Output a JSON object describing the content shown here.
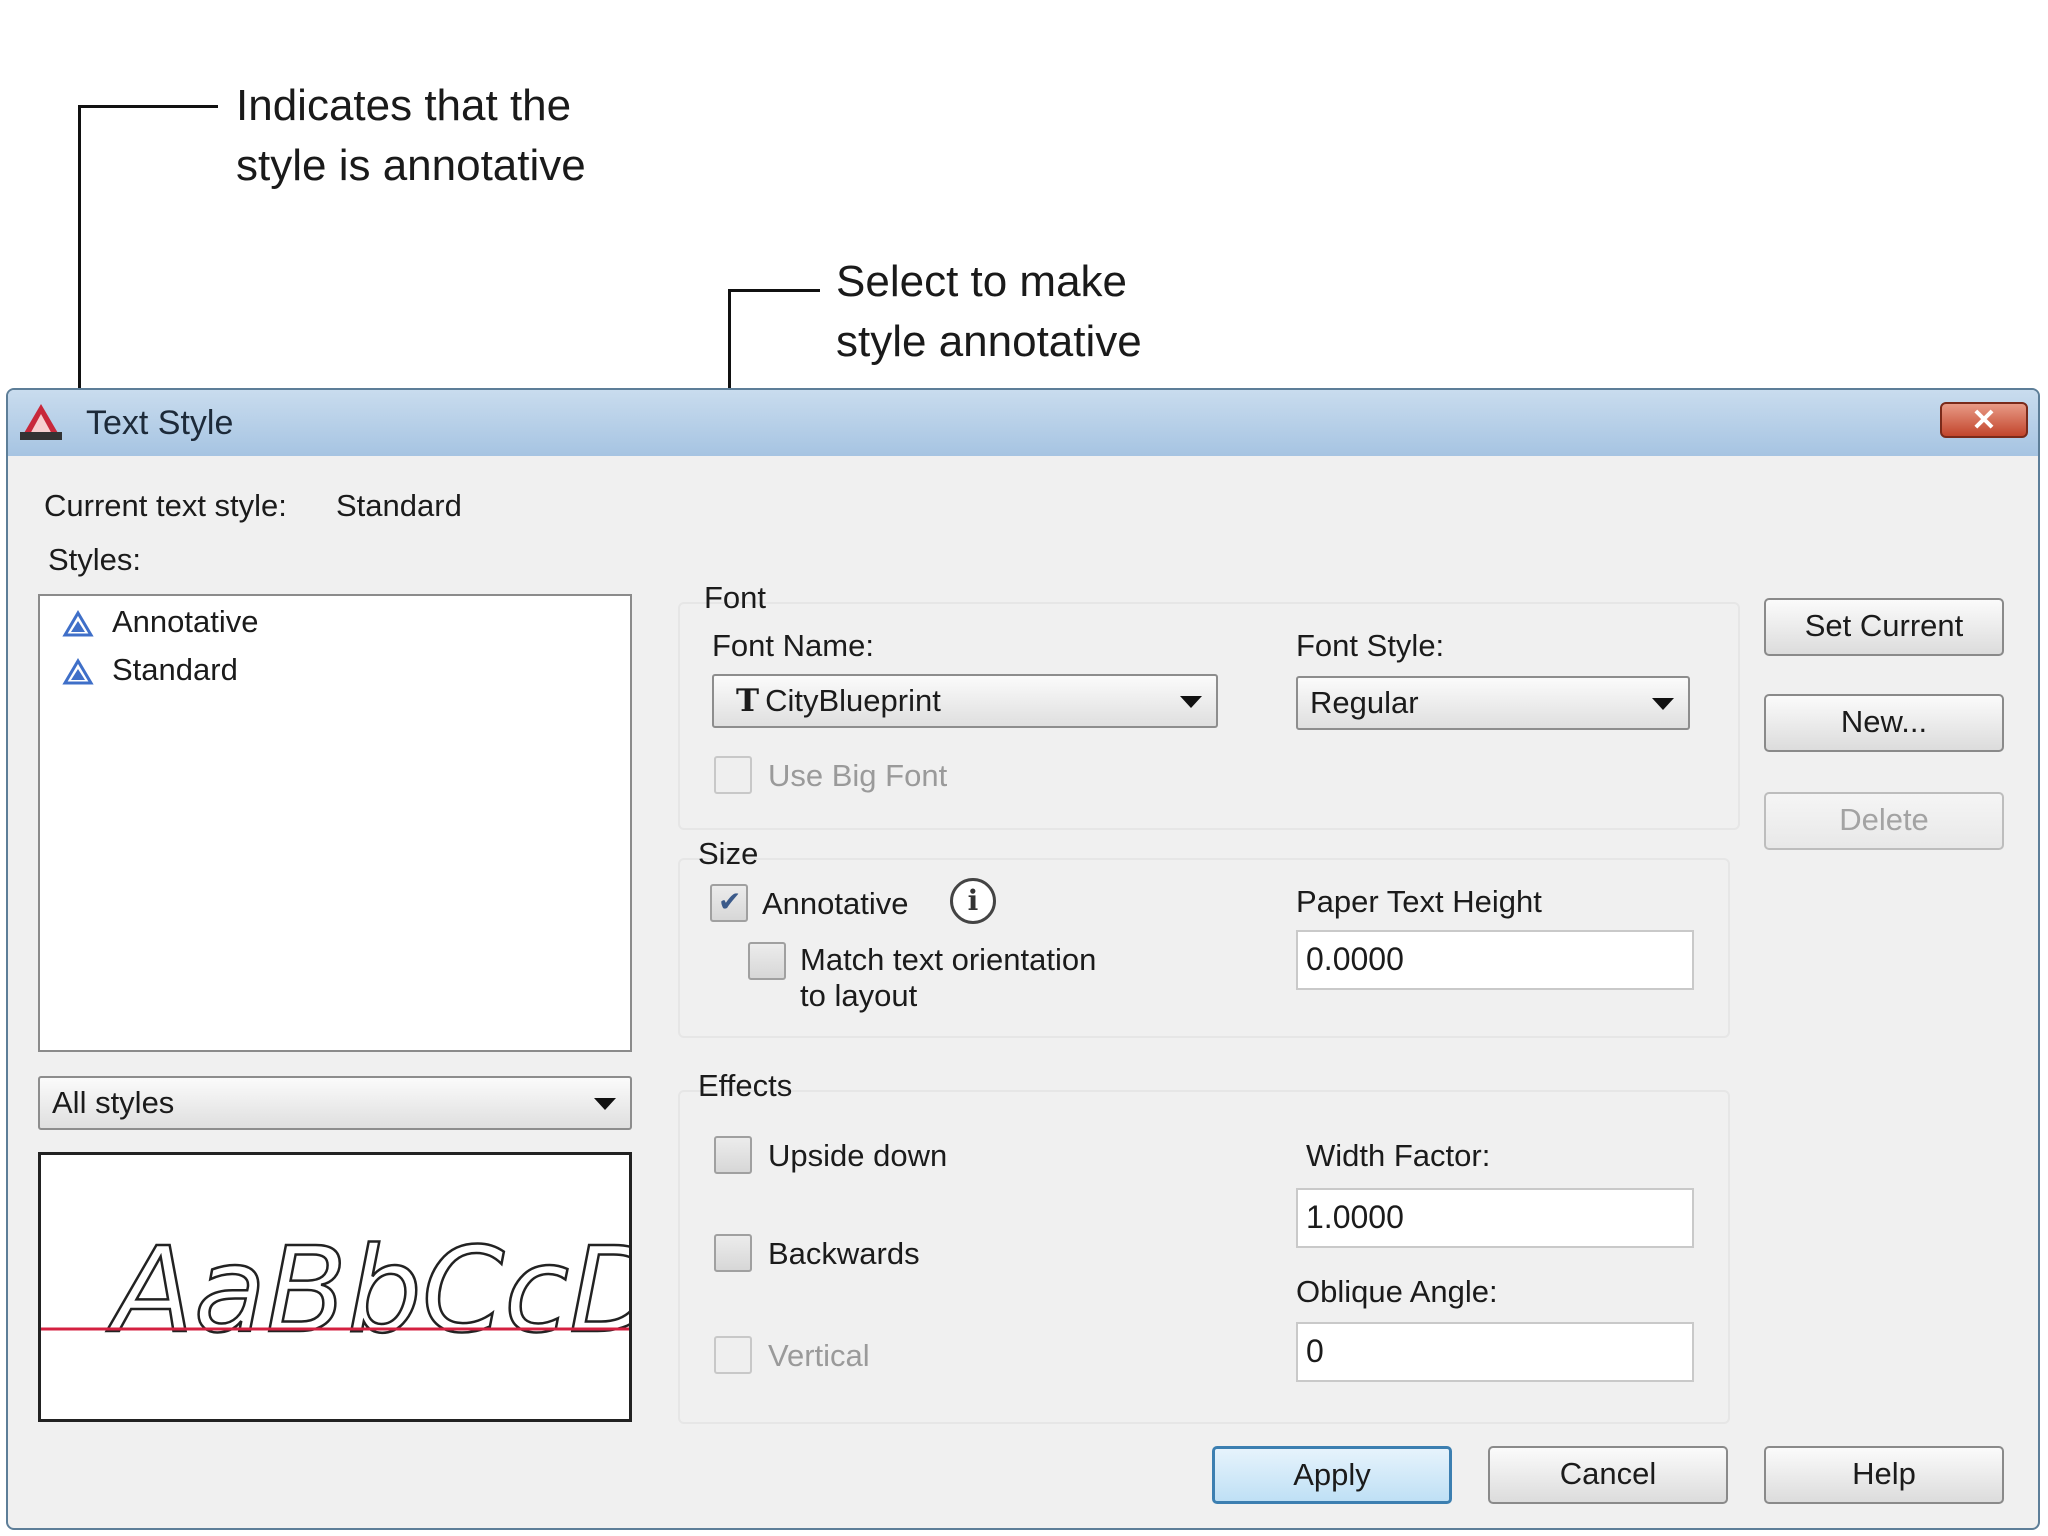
{
  "callouts": {
    "annotative_indicator": "Indicates that the\nstyle is annotative",
    "select_annotative": "Select to make\nstyle annotative"
  },
  "window": {
    "title": "Text Style",
    "close_label": "✕"
  },
  "current_style": {
    "label": "Current text style:",
    "value": "Standard"
  },
  "styles": {
    "label": "Styles:",
    "items": [
      {
        "label": "Annotative",
        "icon": "annotative-triangle-icon"
      },
      {
        "label": "Standard",
        "icon": "annotative-triangle-icon"
      }
    ],
    "filter_value": "All styles"
  },
  "preview_text": "AaBbCcD",
  "font": {
    "group_label": "Font",
    "font_name_label": "Font Name:",
    "font_name_value": "CityBlueprint",
    "font_style_label": "Font Style:",
    "font_style_value": "Regular",
    "use_big_font_label": "Use Big Font"
  },
  "size": {
    "group_label": "Size",
    "annotative_label": "Annotative",
    "annotative_checked": true,
    "match_orientation_label": "Match text orientation\nto layout",
    "paper_text_height_label": "Paper Text Height",
    "paper_text_height_value": "0.0000"
  },
  "effects": {
    "group_label": "Effects",
    "upside_down_label": "Upside down",
    "backwards_label": "Backwards",
    "vertical_label": "Vertical",
    "width_factor_label": "Width Factor:",
    "width_factor_value": "1.0000",
    "oblique_angle_label": "Oblique Angle:",
    "oblique_angle_value": "0"
  },
  "buttons": {
    "set_current": "Set Current",
    "new": "New...",
    "delete": "Delete",
    "apply": "Apply",
    "cancel": "Cancel",
    "help": "Help"
  },
  "colors": {
    "titlebar": "#a6c4e2",
    "preview_baseline": "#d42040",
    "annotative_icon": "#3f6fc8",
    "default_button_border": "#3c7fb1"
  }
}
